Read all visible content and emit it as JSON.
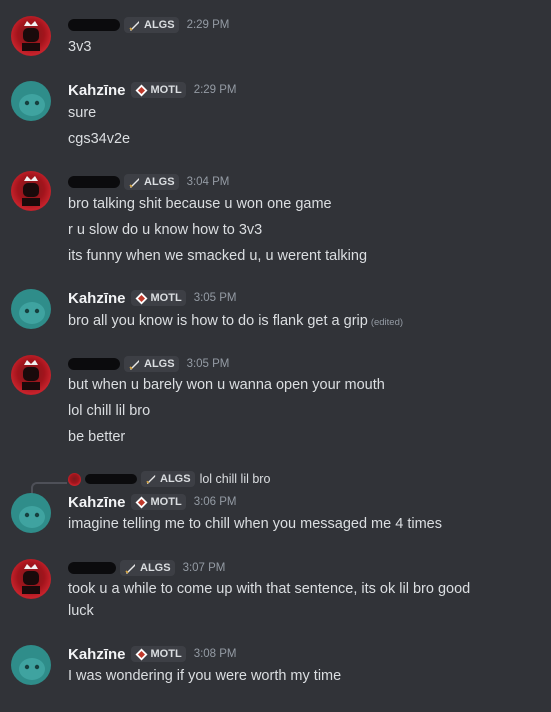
{
  "colors": {
    "background": "#313338",
    "text": "#dbdee1",
    "muted": "#949ba4",
    "name": "#f2f3f5",
    "tag_bg": "#3d3f45"
  },
  "icons": {
    "algs_tag": "sword-icon",
    "motl_tag": "diamond-emblem-icon"
  },
  "messages": [
    {
      "time": "2:29 PM",
      "tag": "ALGS",
      "lines": [
        "3v3"
      ]
    },
    {
      "author": "Kahzīne",
      "time": "2:29 PM",
      "tag": "MOTL",
      "lines": [
        "sure",
        "cgs34v2e"
      ]
    },
    {
      "time": "3:04 PM",
      "tag": "ALGS",
      "lines": [
        "bro talking shit because u won one game",
        "r u slow do u know how to 3v3",
        "its funny when we smacked u, u werent talking"
      ]
    },
    {
      "author": "Kahzīne",
      "time": "3:05 PM",
      "tag": "MOTL",
      "lines": [
        "bro all you know is how to do is flank get a grip"
      ],
      "edited": "(edited)"
    },
    {
      "time": "3:05 PM",
      "tag": "ALGS",
      "lines": [
        "but when u barely won u wanna open your mouth",
        "lol chill lil bro",
        "be better"
      ]
    },
    {
      "author": "Kahzīne",
      "time": "3:06 PM",
      "tag": "MOTL",
      "reply": {
        "tag": "ALGS",
        "text": "lol chill lil bro"
      },
      "lines": [
        "imagine telling me to chill when you messaged me 4 times"
      ]
    },
    {
      "time": "3:07 PM",
      "tag": "ALGS",
      "lines": [
        "took u a while to come up with that sentence, its ok lil bro good",
        "luck"
      ]
    },
    {
      "author": "Kahzīne",
      "time": "3:08 PM",
      "tag": "MOTL",
      "lines": [
        "I was wondering if you were worth my time"
      ]
    }
  ]
}
